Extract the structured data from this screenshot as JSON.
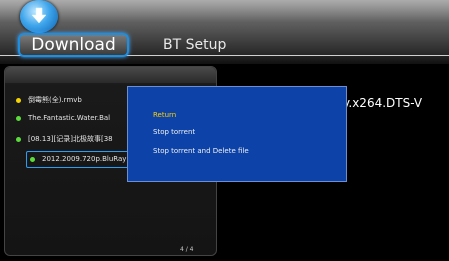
{
  "header": {
    "tabs": [
      {
        "label": "Download",
        "selected": true
      },
      {
        "label": "BT Setup",
        "selected": false
      }
    ]
  },
  "list": {
    "items": [
      {
        "name": "倒霉熊(全).rmvb",
        "status_color": "#f5d300"
      },
      {
        "name": "The.Fantastic.Water.Bal",
        "status_color": "#5cdc3c"
      },
      {
        "name": "[08.13][记录]北极故事[38",
        "status_color": "#5cdc3c"
      },
      {
        "name": "2012.2009.720p.BluRay",
        "status_color": "#5cdc3c",
        "selected": true
      }
    ],
    "page_indicator": "4 / 4"
  },
  "detail": {
    "title_fragment": "y.x264.DTS-V"
  },
  "popup": {
    "items": [
      {
        "label": "Return",
        "highlighted": true
      },
      {
        "label": "Stop torrent"
      },
      {
        "label": "Stop torrent and Delete file"
      }
    ],
    "highlight_color": "#ffd200",
    "background_color": "#0d43a8"
  },
  "icons": {
    "logo": "download-arrow-icon"
  }
}
